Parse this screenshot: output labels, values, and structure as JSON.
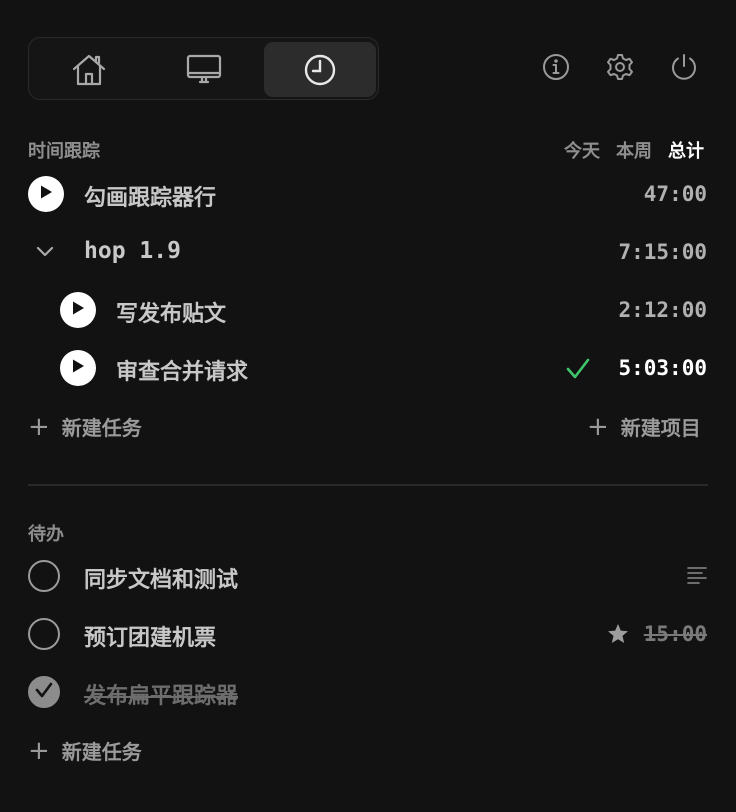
{
  "tabs": [
    {
      "id": "home",
      "icon": "home-icon",
      "active": false
    },
    {
      "id": "display",
      "icon": "monitor-icon",
      "active": false
    },
    {
      "id": "clock",
      "icon": "clock-icon",
      "active": true
    }
  ],
  "top_icons": [
    "info-icon",
    "gear-icon",
    "power-icon"
  ],
  "tracking": {
    "title": "时间跟踪",
    "ranges": {
      "today": "今天",
      "week": "本周",
      "total": "总计",
      "selected": "total"
    },
    "rows": [
      {
        "label": "勾画跟踪器行",
        "time": "47:00",
        "type": "task"
      },
      {
        "label": "hop 1.9",
        "time": "7:15:00",
        "type": "project",
        "expanded": true
      },
      {
        "label": "写发布贴文",
        "time": "2:12:00",
        "type": "subtask"
      },
      {
        "label": "审查合并请求",
        "time": "5:03:00",
        "type": "subtask",
        "completed": true
      }
    ],
    "add_task": "新建任务",
    "add_project": "新建项目"
  },
  "todo": {
    "title": "待办",
    "items": [
      {
        "label": "同步文档和测试",
        "checked": false,
        "has_notes": true
      },
      {
        "label": "预订团建机票",
        "checked": false,
        "starred": true,
        "estimate": "15:00"
      },
      {
        "label": "发布扁平跟踪器",
        "checked": true
      }
    ],
    "add_task": "新建任务"
  },
  "colors": {
    "background": "#121212",
    "check_green": "#3fc66a",
    "accent_white": "#ffffff"
  }
}
